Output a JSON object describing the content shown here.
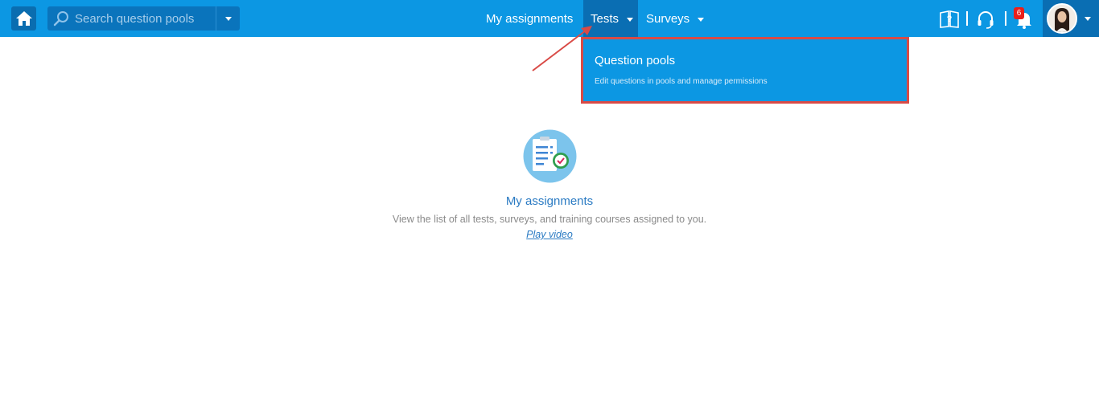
{
  "search": {
    "placeholder": "Search question pools"
  },
  "nav": {
    "items": [
      {
        "label": "My assignments"
      },
      {
        "label": "Tests"
      },
      {
        "label": "Surveys"
      }
    ]
  },
  "dropdown": {
    "title": "Question pools",
    "subtitle": "Edit questions in pools and manage permissions"
  },
  "notifications": {
    "count": "6"
  },
  "icons": {
    "home": "home-icon",
    "search": "search-icon",
    "help": "help-book-icon",
    "support": "headset-icon",
    "notifications": "bell-icon",
    "feature": "clipboard-check-icon"
  },
  "feature": {
    "title": "My assignments",
    "description": "View the list of all tests, surveys, and training courses assigned to you.",
    "link": "Play video"
  },
  "colors": {
    "topbar": "#0c97e3",
    "active_nav": "#0a6eb3",
    "highlight_border": "#d94a46",
    "badge": "#e8201c",
    "link": "#2b7bc3"
  }
}
